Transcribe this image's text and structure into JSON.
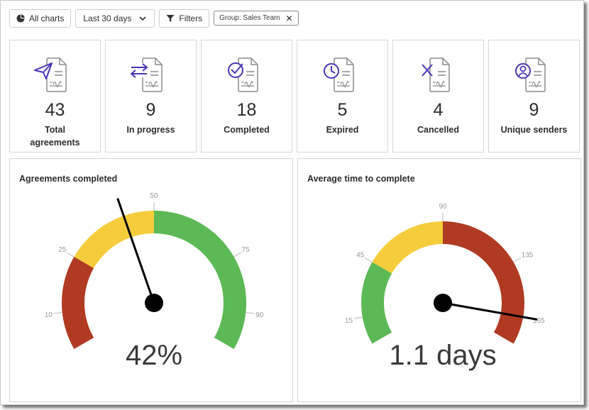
{
  "toolbar": {
    "all_charts_label": "All charts",
    "range_label": "Last 30 days",
    "filters_label": "Filters",
    "group_tag_label": "Group: Sales Team"
  },
  "kpis": [
    {
      "value": "43",
      "label": "Total agreements",
      "icon": "send-icon"
    },
    {
      "value": "9",
      "label": "In progress",
      "icon": "arrows-exchange-icon"
    },
    {
      "value": "18",
      "label": "Completed",
      "icon": "check-circle-icon"
    },
    {
      "value": "5",
      "label": "Expired",
      "icon": "clock-icon"
    },
    {
      "value": "4",
      "label": "Cancelled",
      "icon": "x-icon"
    },
    {
      "value": "9",
      "label": "Unique senders",
      "icon": "user-icon"
    }
  ],
  "colors": {
    "red": "#b03a22",
    "yellow": "#f5cd3c",
    "green": "#5cb955",
    "icon_accent": "#4b35b7",
    "icon_doc": "#8c8c8c"
  },
  "chart_data": [
    {
      "type": "gauge",
      "title": "Agreements completed",
      "range": [
        0,
        100
      ],
      "bands": [
        {
          "from": 0,
          "to": 25,
          "color": "#b03a22"
        },
        {
          "from": 25,
          "to": 50,
          "color": "#f5cd3c"
        },
        {
          "from": 50,
          "to": 100,
          "color": "#5cb955"
        }
      ],
      "ticks": [
        10,
        25,
        50,
        75,
        90
      ],
      "value": 42,
      "value_label": "42%"
    },
    {
      "type": "gauge",
      "title": "Average time to complete",
      "range": [
        0,
        180
      ],
      "bands": [
        {
          "from": 0,
          "to": 45,
          "color": "#5cb955"
        },
        {
          "from": 45,
          "to": 90,
          "color": "#f5cd3c"
        },
        {
          "from": 90,
          "to": 180,
          "color": "#b03a22"
        }
      ],
      "ticks": [
        15,
        45,
        90,
        135,
        165
      ],
      "value": 165,
      "value_label": "1.1 days"
    }
  ]
}
